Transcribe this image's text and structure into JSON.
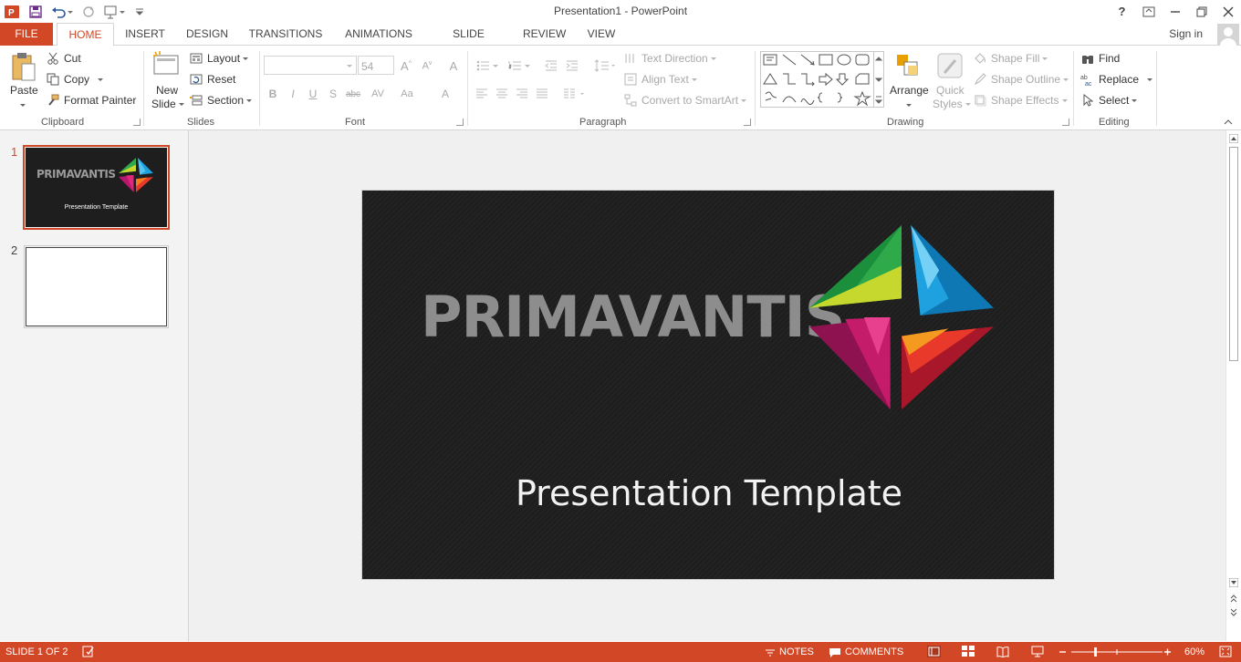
{
  "window": {
    "title": "Presentation1 - PowerPoint",
    "help": "?"
  },
  "account": {
    "signin": "Sign in"
  },
  "tabs": [
    "FILE",
    "HOME",
    "INSERT",
    "DESIGN",
    "TRANSITIONS",
    "ANIMATIONS",
    "SLIDE SHOW",
    "REVIEW",
    "VIEW"
  ],
  "ribbon": {
    "clipboard": {
      "paste": "Paste",
      "cut": "Cut",
      "copy": "Copy",
      "format_painter": "Format Painter",
      "label": "Clipboard"
    },
    "slides": {
      "new_slide_line1": "New",
      "new_slide_line2": "Slide",
      "layout": "Layout",
      "reset": "Reset",
      "section": "Section",
      "label": "Slides"
    },
    "font": {
      "font_size": "54",
      "label": "Font"
    },
    "paragraph": {
      "text_direction": "Text Direction",
      "align_text": "Align Text",
      "convert_smartart": "Convert to SmartArt",
      "label": "Paragraph"
    },
    "drawing": {
      "arrange": "Arrange",
      "quick_styles_line1": "Quick",
      "quick_styles_line2": "Styles",
      "shape_fill": "Shape Fill",
      "shape_outline": "Shape Outline",
      "shape_effects": "Shape Effects",
      "label": "Drawing"
    },
    "editing": {
      "find": "Find",
      "replace": "Replace",
      "select": "Select",
      "label": "Editing"
    }
  },
  "thumbnails": [
    {
      "number": "1",
      "brand": "PRIMAVANTIS",
      "subtitle": "Presentation Template"
    },
    {
      "number": "2"
    }
  ],
  "slide": {
    "brand": "PRIMAVANTIS",
    "subtitle": "Presentation Template"
  },
  "status": {
    "slide_info": "SLIDE 1 OF 2",
    "notes": "NOTES",
    "comments": "COMMENTS",
    "zoom": "60%"
  },
  "colors": {
    "accent": "#d24726",
    "slide_bg": "#1e1e1e"
  }
}
